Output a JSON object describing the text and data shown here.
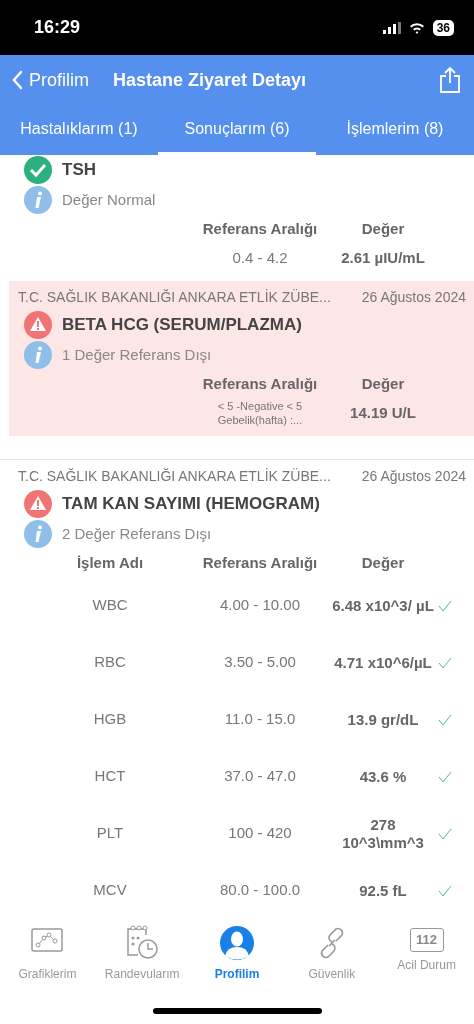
{
  "status_bar": {
    "time": "16:29",
    "battery": "36"
  },
  "nav": {
    "back": "Profilim",
    "title": "Hastane Ziyaret Detayı"
  },
  "tabs": [
    {
      "label": "Hastalıklarım (1)",
      "selected": false
    },
    {
      "label": "Sonuçlarım (6)",
      "selected": true
    },
    {
      "label": "İşlemlerim (8)",
      "selected": false
    }
  ],
  "results": [
    {
      "title": "TSH",
      "kind": "normal",
      "summary": "Değer Normal",
      "highlighted": false,
      "columns": [
        "Referans Aralığı",
        "Değer"
      ],
      "rows": [
        {
          "range": "0.4 - 4.2",
          "value": "2.61 µIU/mL",
          "small_range": false
        }
      ]
    },
    {
      "hospital": "T.C. SAĞLIK BAKANLIĞI ANKARA ETLİK ZÜBE...",
      "date": "26 Ağustos 2024",
      "title": "BETA HCG (SERUM/PLAZMA)",
      "kind": "abnormal",
      "summary": "1 Değer Referans Dışı",
      "highlighted": true,
      "columns": [
        "Referans Aralığı",
        "Değer"
      ],
      "rows": [
        {
          "range": "< 5 -Negative < 5 Gebelik(hafta) :...",
          "value": "14.19 U/L",
          "small_range": true
        }
      ]
    },
    {
      "hospital": "T.C. SAĞLIK BAKANLIĞI ANKARA ETLİK ZÜBE...",
      "date": "26 Ağustos 2024",
      "title": "TAM KAN SAYIMI (HEMOGRAM)",
      "kind": "abnormal",
      "summary": "2 Değer Referans Dışı",
      "highlighted": false,
      "columns": [
        "İşlem Adı",
        "Referans Aralığı",
        "Değer"
      ],
      "rows": [
        {
          "name": "WBC",
          "range": "4.00 - 10.00",
          "value": "6.48 x10^3/ µL",
          "small_range": false,
          "checked": true
        },
        {
          "name": "RBC",
          "range": "3.50 - 5.00",
          "value": "4.71 x10^6/µL",
          "small_range": false,
          "checked": true
        },
        {
          "name": "HGB",
          "range": "11.0 - 15.0",
          "value": "13.9 gr/dL",
          "small_range": false,
          "checked": true
        },
        {
          "name": "HCT",
          "range": "37.0 - 47.0",
          "value": "43.6 %",
          "small_range": false,
          "checked": true
        },
        {
          "name": "PLT",
          "range": "100 - 420",
          "value": "278 10^3\\mm^3",
          "small_range": false,
          "checked": true
        },
        {
          "name": "MCV",
          "range": "80.0 - 100.0",
          "value": "92.5 fL",
          "small_range": false,
          "checked": true
        }
      ]
    }
  ],
  "bottom_tabs": [
    {
      "kind": "chart",
      "label": "Grafiklerim",
      "selected": false
    },
    {
      "kind": "calendar",
      "label": "Randevularım",
      "selected": false
    },
    {
      "kind": "profile",
      "label": "Profilim",
      "selected": true
    },
    {
      "kind": "link",
      "label": "Güvenlik",
      "selected": false
    },
    {
      "kind": "badge",
      "badge_text": "112",
      "label": "Acil Durum",
      "selected": false
    }
  ]
}
